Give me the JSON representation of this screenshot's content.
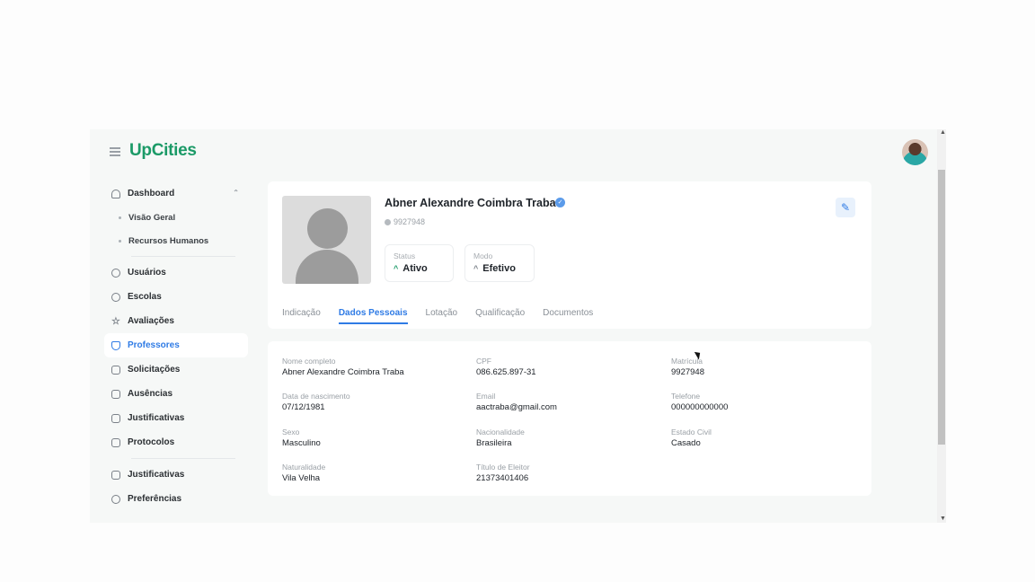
{
  "app": {
    "logo": "UpCities"
  },
  "sidebar": {
    "items": [
      {
        "label": "Dashboard"
      },
      {
        "label": "Usuários"
      },
      {
        "label": "Escolas"
      },
      {
        "label": "Avaliações"
      },
      {
        "label": "Professores"
      },
      {
        "label": "Solicitações"
      },
      {
        "label": "Ausências"
      },
      {
        "label": "Justificativas"
      },
      {
        "label": "Protocolos"
      },
      {
        "label": "Justificativas"
      },
      {
        "label": "Preferências"
      }
    ],
    "sub_items": [
      {
        "label": "Visão Geral"
      },
      {
        "label": "Recursos Humanos"
      }
    ],
    "active": "Professores"
  },
  "profile": {
    "name": "Abner Alexandre Coimbra Traba",
    "id": "9927948",
    "status_label": "Status",
    "status_value": "Ativo",
    "modo_label": "Modo",
    "modo_value": "Efetivo"
  },
  "tabs": [
    {
      "label": "Indicação"
    },
    {
      "label": "Dados Pessoais"
    },
    {
      "label": "Lotação"
    },
    {
      "label": "Qualificação"
    },
    {
      "label": "Documentos"
    }
  ],
  "active_tab": "Dados Pessoais",
  "details": {
    "fields": [
      {
        "label": "Nome completo",
        "value": "Abner Alexandre Coimbra Traba"
      },
      {
        "label": "CPF",
        "value": "086.625.897-31"
      },
      {
        "label": "Matrícula",
        "value": "9927948"
      },
      {
        "label": "Data de nascimento",
        "value": "07/12/1981"
      },
      {
        "label": "Email",
        "value": "aactraba@gmail.com"
      },
      {
        "label": "Telefone",
        "value": "000000000000"
      },
      {
        "label": "Sexo",
        "value": "Masculino"
      },
      {
        "label": "Nacionalidade",
        "value": "Brasileira"
      },
      {
        "label": "Estado Civil",
        "value": "Casado"
      },
      {
        "label": "Naturalidade",
        "value": "Vila Velha"
      },
      {
        "label": "Título de Eleitor",
        "value": "21373401406"
      }
    ]
  },
  "colors": {
    "brand": "#1b9a67",
    "accent": "#2f7be5"
  }
}
